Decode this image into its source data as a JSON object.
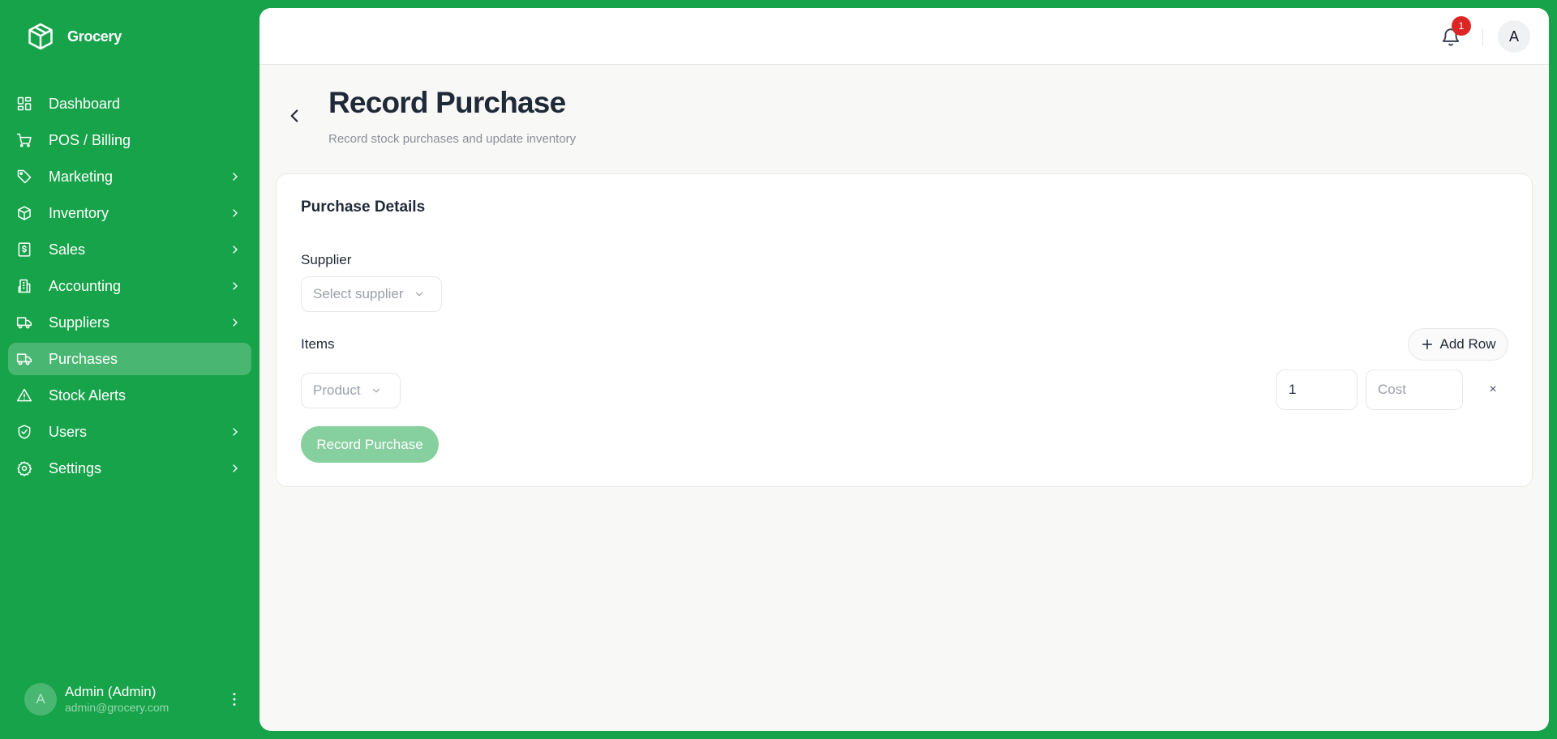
{
  "app": {
    "name": "Grocery"
  },
  "sidebar": {
    "items": [
      {
        "label": "Dashboard",
        "icon": "dashboard-icon",
        "has_children": false,
        "active": false
      },
      {
        "label": "POS / Billing",
        "icon": "cart-icon",
        "has_children": false,
        "active": false
      },
      {
        "label": "Marketing",
        "icon": "tag-icon",
        "has_children": true,
        "active": false
      },
      {
        "label": "Inventory",
        "icon": "box-icon",
        "has_children": true,
        "active": false
      },
      {
        "label": "Sales",
        "icon": "receipt-icon",
        "has_children": true,
        "active": false
      },
      {
        "label": "Accounting",
        "icon": "building-icon",
        "has_children": true,
        "active": false
      },
      {
        "label": "Suppliers",
        "icon": "truck-icon",
        "has_children": true,
        "active": false
      },
      {
        "label": "Purchases",
        "icon": "truck-icon",
        "has_children": false,
        "active": true
      },
      {
        "label": "Stock Alerts",
        "icon": "warning-icon",
        "has_children": false,
        "active": false
      },
      {
        "label": "Users",
        "icon": "shield-icon",
        "has_children": true,
        "active": false
      },
      {
        "label": "Settings",
        "icon": "gear-icon",
        "has_children": true,
        "active": false
      }
    ],
    "user": {
      "initial": "A",
      "name": "Admin (Admin)",
      "email": "admin@grocery.com"
    }
  },
  "topbar": {
    "notification_count": "1",
    "avatar_initial": "A"
  },
  "page": {
    "title": "Record Purchase",
    "subtitle": "Record stock purchases and update inventory"
  },
  "form": {
    "card_title": "Purchase Details",
    "supplier_label": "Supplier",
    "supplier_placeholder": "Select supplier",
    "items_label": "Items",
    "add_row_label": "Add Row",
    "rows": [
      {
        "product_placeholder": "Product",
        "quantity": "1",
        "cost_placeholder": "Cost",
        "remove_label": "×"
      }
    ],
    "submit_label": "Record Purchase"
  },
  "colors": {
    "brand_green": "#17a34a",
    "submit_disabled": "#86cf9f",
    "badge_red": "#dc2626"
  }
}
